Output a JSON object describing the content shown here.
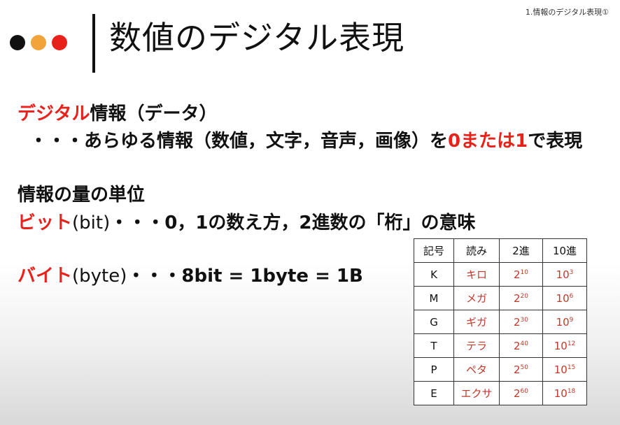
{
  "header": {
    "corner_label": "1.情報のデジタル表現①",
    "title": "数値のデジタル表現",
    "dot_colors": [
      "#111111",
      "#f2a33a",
      "#e8221b"
    ]
  },
  "body": {
    "l1": {
      "red": "デジタル",
      "rest": "情報（データ）"
    },
    "l2": {
      "prefix": "・・・あらゆる情報（数値，文字，音声，画像）を",
      "red": "0または1",
      "suffix": "で表現"
    },
    "l3": {
      "text": "情報の量の単位"
    },
    "l4": {
      "red": "ビット",
      "label": "(bit)",
      "rest": "・・・0，1の数え方，2進数の「桁」の意味"
    },
    "l5": {
      "red": "バイト",
      "label": "(byte)",
      "rest": "・・・8bit = 1byte = 1B"
    }
  },
  "table": {
    "headers": [
      "記号",
      "読み",
      "2進",
      "10進"
    ],
    "rows": [
      {
        "sym": "K",
        "read": "キロ",
        "bin_base": "2",
        "bin_exp": "10",
        "dec_base": "10",
        "dec_exp": "3"
      },
      {
        "sym": "M",
        "read": "メガ",
        "bin_base": "2",
        "bin_exp": "20",
        "dec_base": "10",
        "dec_exp": "6"
      },
      {
        "sym": "G",
        "read": "ギガ",
        "bin_base": "2",
        "bin_exp": "30",
        "dec_base": "10",
        "dec_exp": "9"
      },
      {
        "sym": "T",
        "read": "テラ",
        "bin_base": "2",
        "bin_exp": "40",
        "dec_base": "10",
        "dec_exp": "12"
      },
      {
        "sym": "P",
        "read": "ペタ",
        "bin_base": "2",
        "bin_exp": "50",
        "dec_base": "10",
        "dec_exp": "15"
      },
      {
        "sym": "E",
        "read": "エクサ",
        "bin_base": "2",
        "bin_exp": "60",
        "dec_base": "10",
        "dec_exp": "18"
      }
    ]
  }
}
